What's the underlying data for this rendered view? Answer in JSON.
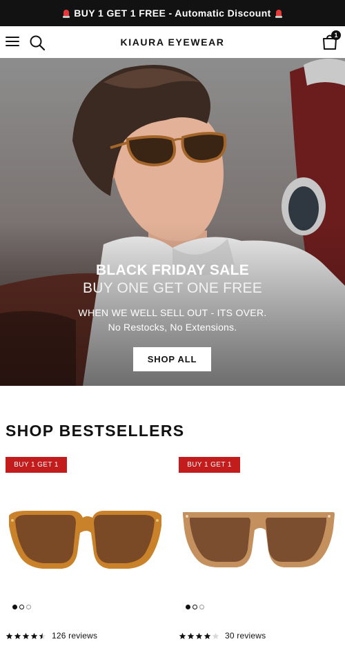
{
  "announcement": {
    "text": "BUY 1 GET 1 FREE - Automatic Discount",
    "left_icon": "siren-icon",
    "right_icon": "siren-icon"
  },
  "header": {
    "logo": "KIAURA EYEWEAR",
    "menu_icon": "hamburger-menu-icon",
    "search_icon": "search-icon",
    "cart_icon": "shopping-bag-icon",
    "cart_count": "1"
  },
  "hero": {
    "title": "BLACK FRIDAY SALE",
    "subtitle": "BUY ONE GET ONE FREE",
    "line1": "WHEN WE WELL SELL OUT - ITS OVER.",
    "line2": "No Restocks, No Extensions.",
    "cta": "SHOP ALL"
  },
  "section": {
    "title": "SHOP BESTSELLERS"
  },
  "products": [
    {
      "badge": "BUY 1 GET 1",
      "frame_color": "#c9822a",
      "lens_color": "#7a4a26",
      "image_dots": 3,
      "active_dot": 1,
      "rating": 4.5,
      "reviews": "126 reviews"
    },
    {
      "badge": "BUY 1 GET 1",
      "frame_color": "#c4915e",
      "lens_color": "#7b4e2f",
      "image_dots": 3,
      "active_dot": 1,
      "rating": 4,
      "reviews": "30 reviews"
    }
  ],
  "colors": {
    "announcement_bg": "#121212",
    "badge_red": "#c21c1c",
    "text_dark": "#111111"
  }
}
